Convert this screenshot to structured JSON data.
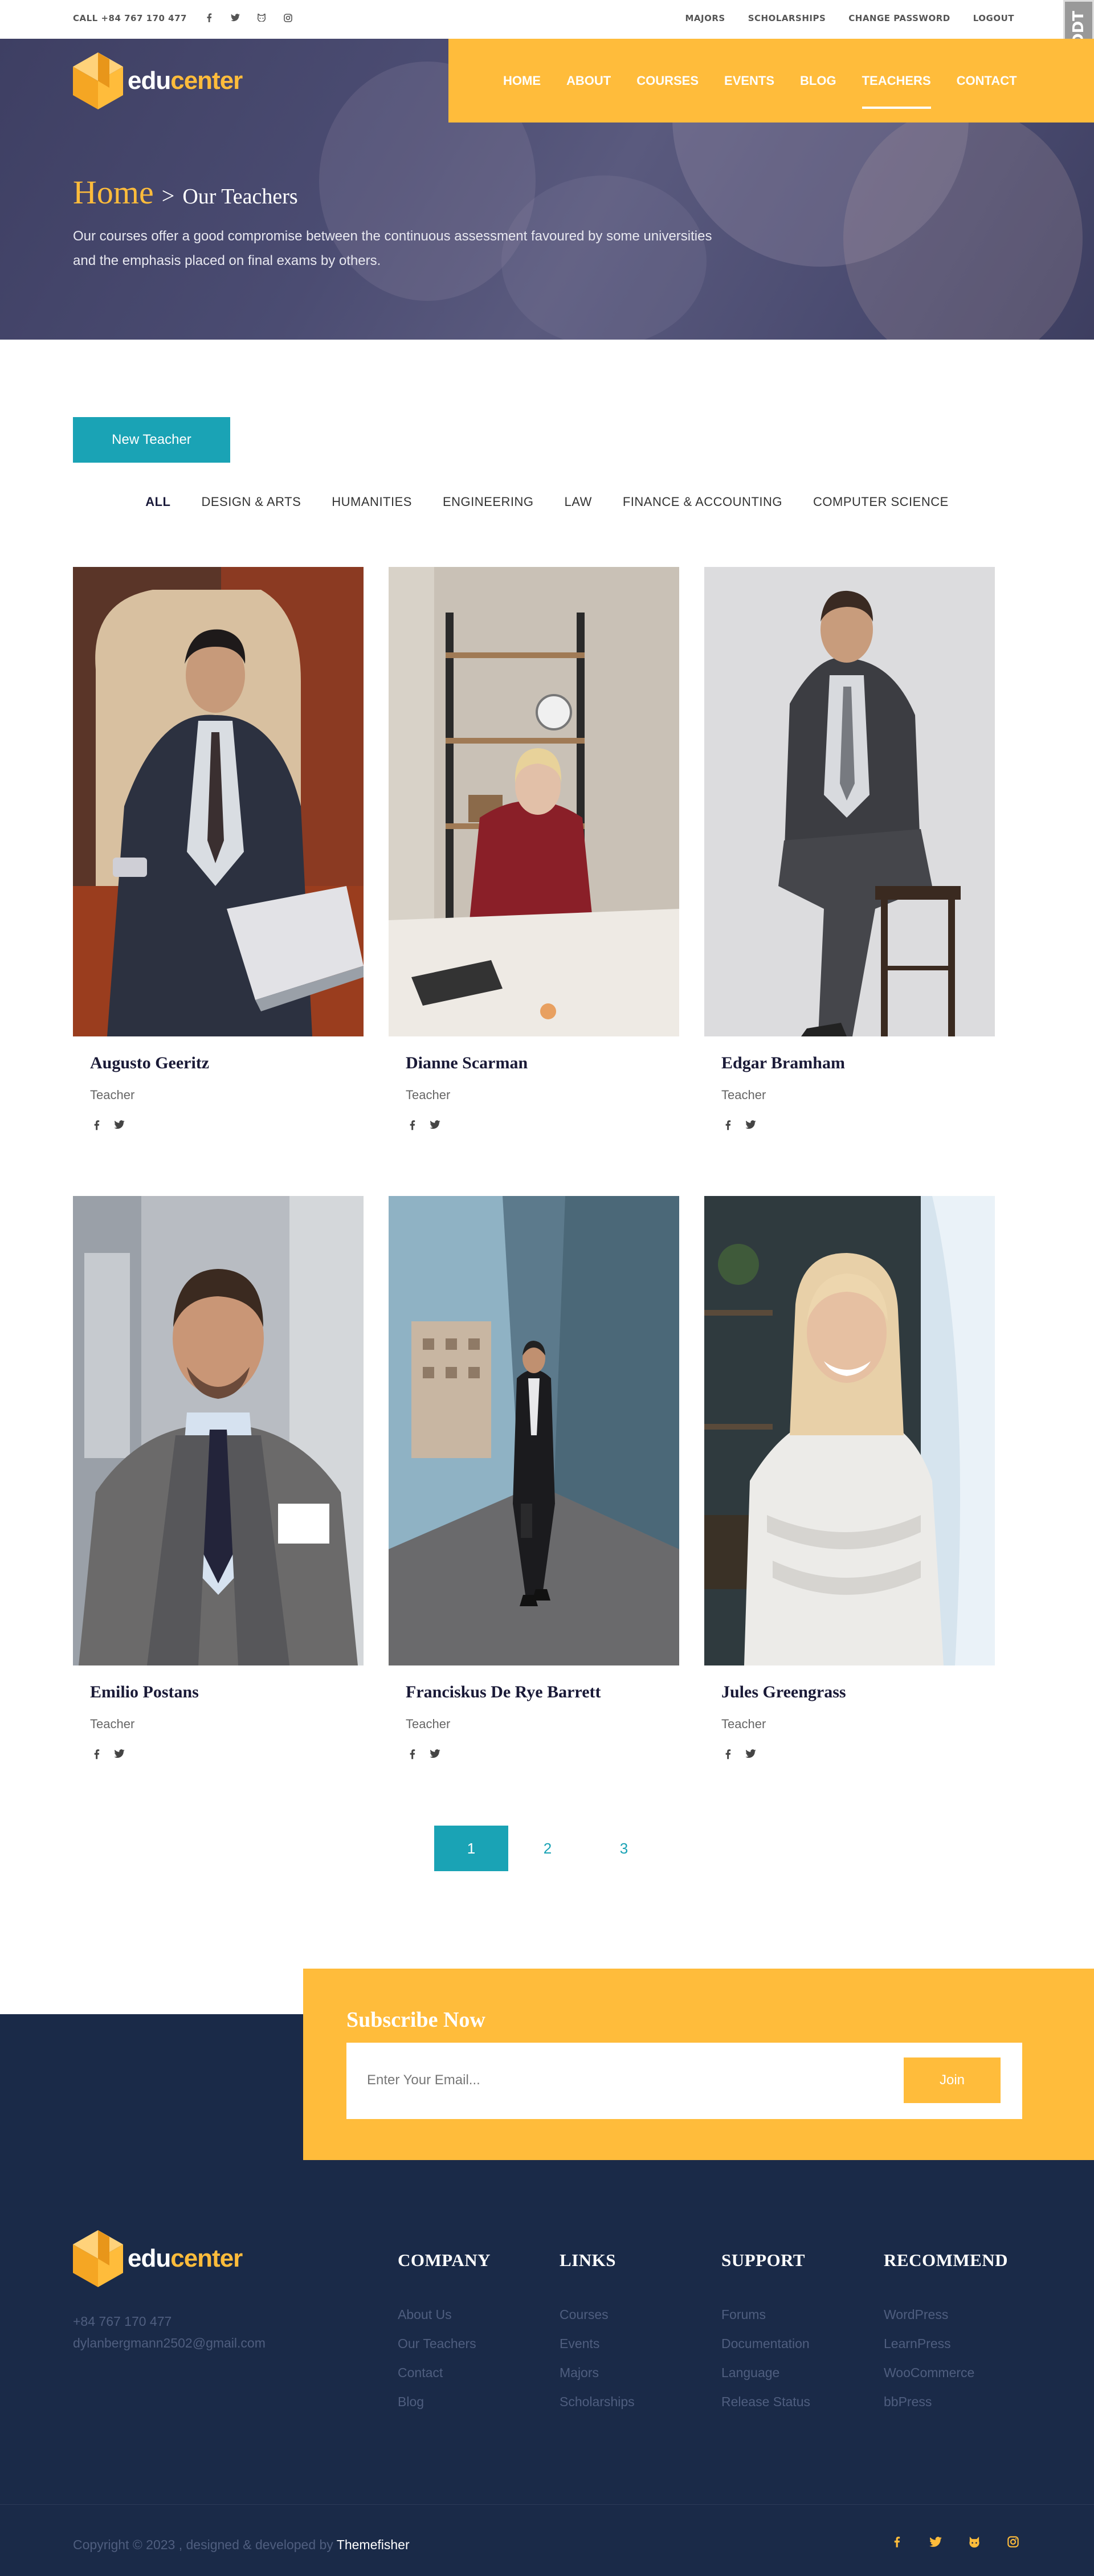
{
  "topbar": {
    "call": "CALL +84 767 170 477",
    "links": [
      "MAJORS",
      "SCHOLARSHIPS",
      "CHANGE PASSWORD",
      "LOGOUT"
    ],
    "badge": "DDT"
  },
  "brand": {
    "edu": "edu",
    "center": "center"
  },
  "nav": [
    "HOME",
    "ABOUT",
    "COURSES",
    "EVENTS",
    "BLOG",
    "TEACHERS",
    "CONTACT"
  ],
  "hero": {
    "home": "Home",
    "separator": ">",
    "current": "Our Teachers",
    "description": "Our courses offer a good compromise between the continuous assessment favoured by some universities and the emphasis placed on final exams by others."
  },
  "actions": {
    "new_teacher": "New Teacher"
  },
  "filters": [
    "ALL",
    "DESIGN & ARTS",
    "HUMANITIES",
    "ENGINEERING",
    "LAW",
    "FINANCE & ACCOUNTING",
    "COMPUTER SCIENCE"
  ],
  "teachers": [
    {
      "name": "Augusto Geeritz",
      "role": "Teacher"
    },
    {
      "name": "Dianne Scarman",
      "role": "Teacher"
    },
    {
      "name": "Edgar Bramham",
      "role": "Teacher"
    },
    {
      "name": "Emilio Postans",
      "role": "Teacher"
    },
    {
      "name": "Franciskus De Rye Barrett",
      "role": "Teacher"
    },
    {
      "name": "Jules Greengrass",
      "role": "Teacher"
    }
  ],
  "pagination": [
    "1",
    "2",
    "3"
  ],
  "subscribe": {
    "title": "Subscribe Now",
    "placeholder": "Enter Your Email...",
    "button": "Join"
  },
  "footer": {
    "phone": "+84 767 170 477",
    "email": "dylanbergmann2502@gmail.com",
    "columns": [
      {
        "title": "COMPANY",
        "items": [
          "About Us",
          "Our Teachers",
          "Contact",
          "Blog"
        ]
      },
      {
        "title": "LINKS",
        "items": [
          "Courses",
          "Events",
          "Majors",
          "Scholarships"
        ]
      },
      {
        "title": "SUPPORT",
        "items": [
          "Forums",
          "Documentation",
          "Language",
          "Release Status"
        ]
      },
      {
        "title": "RECOMMEND",
        "items": [
          "WordPress",
          "LearnPress",
          "WooCommerce",
          "bbPress"
        ]
      }
    ],
    "copyright": "Copyright © 2023 , designed & developed by",
    "credit": "Themefisher"
  },
  "icons": {
    "facebook": "facebook-icon",
    "twitter": "twitter-icon",
    "github": "github-icon",
    "instagram": "instagram-icon"
  },
  "colors": {
    "accent": "#ffbc3b",
    "teal": "#1aa3b5",
    "navy": "#1a2a48"
  }
}
